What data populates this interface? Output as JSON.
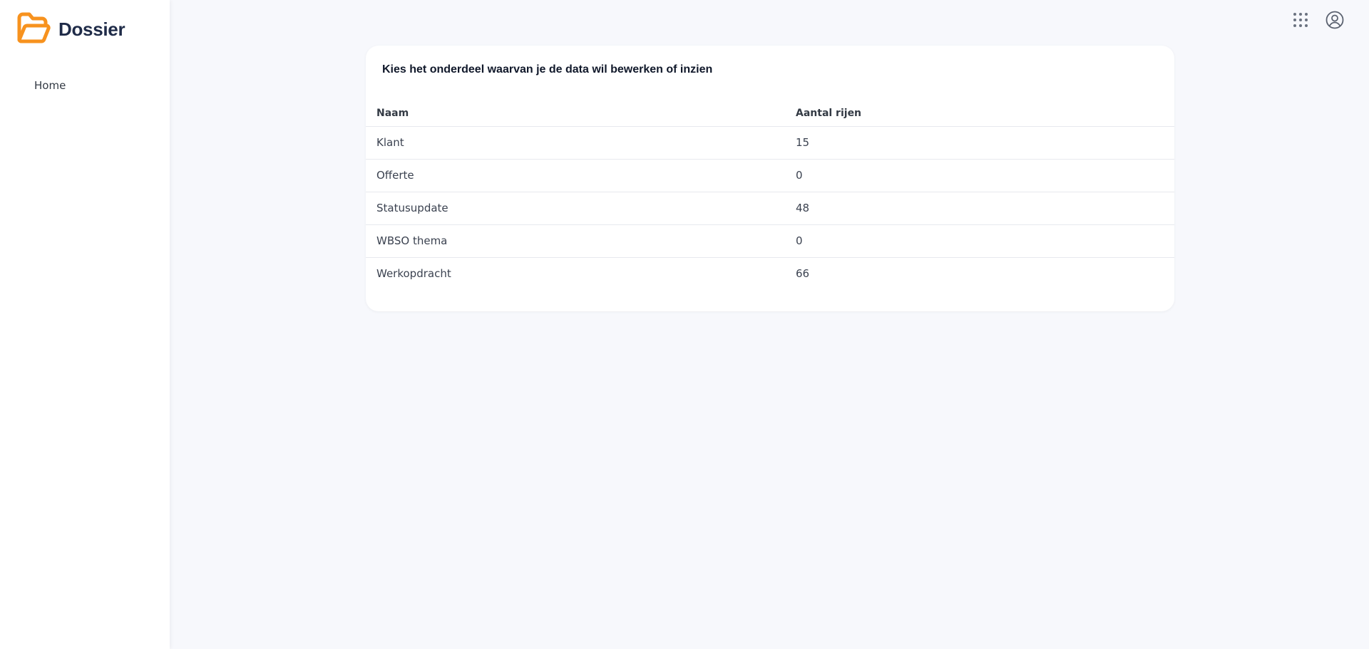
{
  "app": {
    "name": "Dossier",
    "logo_color": "#f7921e"
  },
  "sidebar": {
    "items": [
      {
        "label": "Home"
      }
    ]
  },
  "topbar": {
    "icons": [
      "apps-grid-icon",
      "account-icon"
    ]
  },
  "main": {
    "card_title": "Kies het onderdeel waarvan je de data wil bewerken of inzien",
    "table": {
      "columns": [
        "Naam",
        "Aantal rijen"
      ],
      "rows": [
        {
          "name": "Klant",
          "count": "15"
        },
        {
          "name": "Offerte",
          "count": "0"
        },
        {
          "name": "Statusupdate",
          "count": "48"
        },
        {
          "name": "WBSO thema",
          "count": "0"
        },
        {
          "name": "Werkopdracht",
          "count": "66"
        }
      ]
    }
  }
}
